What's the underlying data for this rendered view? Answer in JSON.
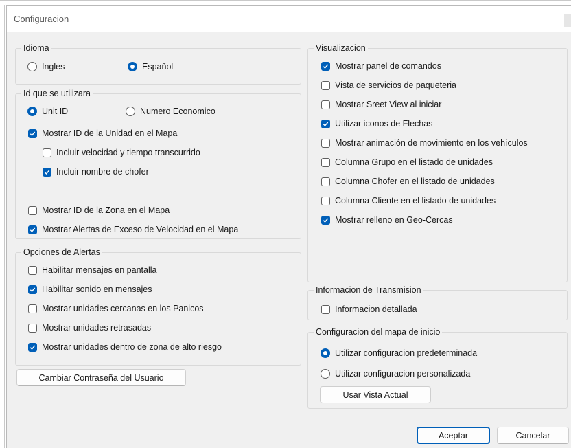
{
  "window": {
    "title": "Configuracion"
  },
  "idioma": {
    "label": "Idioma",
    "options": [
      {
        "label": "Ingles",
        "selected": false
      },
      {
        "label": "Español",
        "selected": true
      }
    ]
  },
  "id_group": {
    "label": "Id que se utilizara",
    "radios": [
      {
        "label": "Unit ID",
        "selected": true
      },
      {
        "label": "Numero Economico",
        "selected": false
      }
    ],
    "checks": [
      {
        "label": "Mostrar ID de la Unidad en el Mapa",
        "checked": true
      },
      {
        "label": "Incluir velocidad y tiempo transcurrido",
        "checked": false
      },
      {
        "label": "Incluir nombre de chofer",
        "checked": true
      },
      {
        "label": "Mostrar ID de la Zona en el Mapa",
        "checked": false
      },
      {
        "label": "Mostrar Alertas de Exceso de Velocidad en el Mapa",
        "checked": true
      }
    ]
  },
  "alertas": {
    "label": "Opciones de Alertas",
    "checks": [
      {
        "label": "Habilitar mensajes en pantalla",
        "checked": false
      },
      {
        "label": "Habilitar sonido en mensajes",
        "checked": true
      },
      {
        "label": "Mostrar unidades cercanas en los Panicos",
        "checked": false
      },
      {
        "label": "Mostrar unidades retrasadas",
        "checked": false
      },
      {
        "label": "Mostrar unidades dentro de zona de alto riesgo",
        "checked": true
      }
    ]
  },
  "change_password_label": "Cambiar Contraseña del Usuario",
  "visualizacion": {
    "label": "Visualizacion",
    "checks": [
      {
        "label": "Mostrar panel de comandos",
        "checked": true
      },
      {
        "label": "Vista de servicios de paqueteria",
        "checked": false
      },
      {
        "label": "Mostrar Sreet View al iniciar",
        "checked": false
      },
      {
        "label": "Utilizar iconos de Flechas",
        "checked": true
      },
      {
        "label": "Mostrar animación de movimiento en los vehículos",
        "checked": false
      },
      {
        "label": "Columna Grupo en el listado de unidades",
        "checked": false
      },
      {
        "label": "Columna Chofer en el listado de unidades",
        "checked": false
      },
      {
        "label": "Columna Cliente en el listado de unidades",
        "checked": false
      },
      {
        "label": "Mostrar relleno en Geo-Cercas",
        "checked": true
      }
    ]
  },
  "transmision": {
    "label": "Informacion de Transmision",
    "checks": [
      {
        "label": "Informacion detallada",
        "checked": false
      }
    ]
  },
  "mapa_inicio": {
    "label": "Configuracion del mapa de inicio",
    "radios": [
      {
        "label": "Utilizar configuracion predeterminada",
        "selected": true
      },
      {
        "label": "Utilizar configuracion personalizada",
        "selected": false
      }
    ],
    "button_label": "Usar Vista Actual"
  },
  "footer": {
    "accept_label": "Aceptar",
    "cancel_label": "Cancelar"
  },
  "colors": {
    "accent": "#005fb8",
    "window_bg": "#f0f0f0",
    "border": "#d9d9d9"
  }
}
